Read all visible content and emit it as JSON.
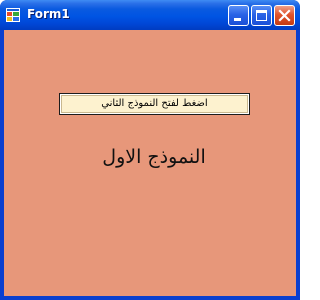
{
  "window": {
    "title": "Form1",
    "controls": {
      "minimize_icon": "minimize-icon",
      "maximize_icon": "maximize-icon",
      "close_icon": "close-icon"
    }
  },
  "form": {
    "open_button_label": "اضغط لفتح النموذج الثاني",
    "label_text": "النموذج الاول"
  },
  "colors": {
    "titlebar": "#0054e3",
    "client_background": "#e7977a",
    "button_background": "#fdf2cf",
    "close_button": "#e0542c"
  }
}
